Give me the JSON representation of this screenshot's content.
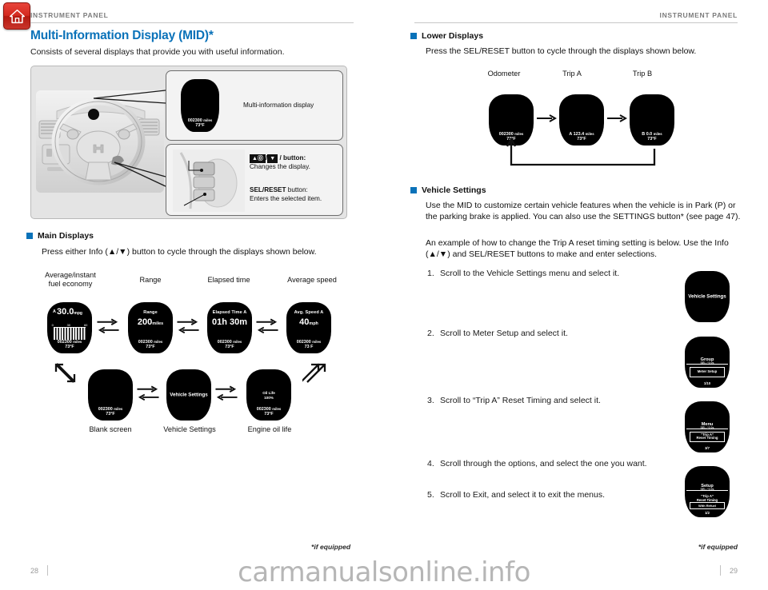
{
  "home_button": {
    "icon": "home-icon",
    "color": "#c9352b"
  },
  "running_head": {
    "left": "INSTRUMENT PANEL",
    "right": "INSTRUMENT PANEL"
  },
  "accent_color": "#0a72b9",
  "left": {
    "title": "Multi-Information Display (MID)*",
    "intro": "Consists of several displays that provide you with useful information.",
    "figure": {
      "callout_top_label": "Multi-information display",
      "callout_button_label_bold": "/  button:",
      "callout_button_prefix_icons": "▲(i) / ▼",
      "callout_button_desc": "Changes the display.",
      "callout_sel_bold": "SEL/RESET",
      "callout_sel_bold_suffix": " button:",
      "callout_sel_desc": "Enters the selected item.",
      "mid_preview": {
        "bottom_value": "002300",
        "bottom_unit": "miles",
        "temp": "73°F"
      }
    },
    "main_displays": {
      "heading": "Main Displays",
      "description": "Press either Info (▲/▼) button to cycle through the displays shown below.",
      "row1_captions": [
        "Average/instant\nfuel economy",
        "Range",
        "Elapsed time",
        "Average speed"
      ],
      "row2_captions": [
        "Blank screen",
        "Vehicle Settings",
        "Engine oil life"
      ],
      "screens": [
        {
          "id": "fuel-economy",
          "top_left": "A",
          "main": "30.0",
          "unit": "mpg",
          "scale": [
            "0",
            "30",
            "60"
          ],
          "odometer": "002300",
          "odo_unit": "miles",
          "temp": "73°F"
        },
        {
          "id": "range",
          "title": "Range",
          "main": "200",
          "unit": "miles",
          "odometer": "002300",
          "odo_unit": "miles",
          "temp": "73°F"
        },
        {
          "id": "elapsed-time",
          "title": "Elapsed Time A",
          "main": "01h 30m",
          "odometer": "002300",
          "odo_unit": "miles",
          "temp": "73°F"
        },
        {
          "id": "average-speed",
          "title": "Avg. Speed A",
          "main": "40",
          "unit": "mph",
          "odometer": "002300",
          "odo_unit": "miles",
          "temp": "73 F"
        },
        {
          "id": "blank-screen",
          "title": "",
          "odometer": "002300",
          "odo_unit": "miles",
          "temp": "73°F"
        },
        {
          "id": "vehicle-settings",
          "center": "Vehicle Settings"
        },
        {
          "id": "engine-oil-life",
          "oil_label": "Oil Life",
          "oil_value": "100%",
          "odometer": "002300",
          "odo_unit": "miles",
          "temp": "73°F"
        }
      ]
    },
    "footnote": "*if equipped",
    "folio": "28"
  },
  "right": {
    "lower_displays": {
      "heading": "Lower Displays",
      "description": "Press the SEL/RESET button to cycle through the displays shown below.",
      "captions": [
        "Odometer",
        "Trip A",
        "Trip B"
      ],
      "screens": [
        {
          "id": "odometer",
          "value": "002300",
          "unit": "miles",
          "temp": "73°F"
        },
        {
          "id": "trip-a",
          "value": "A 123.4",
          "unit": "miles",
          "temp": "73°F"
        },
        {
          "id": "trip-b",
          "value": "B 0.0",
          "unit": "miles",
          "temp": "73°F"
        }
      ]
    },
    "vehicle_settings": {
      "heading": "Vehicle Settings",
      "paragraph1": "Use the MID to customize certain vehicle features when the vehicle is in Park (P) or the parking brake is applied. You can also use the SETTINGS button* (see page 47).",
      "paragraph2": "An example of how to change the Trip A reset timing setting is below. Use the Info (▲/▼) and SEL/RESET buttons to make and enter selections.",
      "steps": [
        {
          "n": "1.",
          "text": "Scroll to the Vehicle Settings menu and select it."
        },
        {
          "n": "2.",
          "text": "Scroll to Meter Setup and select it."
        },
        {
          "n": "3.",
          "text": "Scroll to “Trip A” Reset Timing and select it."
        },
        {
          "n": "4.",
          "text": "Scroll through the options, and select the one you want."
        },
        {
          "n": "5.",
          "text": "Scroll to Exit, and select it to exit the menus."
        }
      ],
      "step_screens": [
        {
          "id": "step1-vehicle-settings",
          "center": "Vehicle Settings"
        },
        {
          "id": "step2-meter-setup",
          "title": "Group",
          "sub": "SEL / 0.0s",
          "box": "Meter Setup",
          "page": "1/10"
        },
        {
          "id": "step3-trip-a-reset-timing",
          "title": "Menu",
          "sub": "SEL / 0.0s",
          "box": "“Trip A”\nReset Timing",
          "page": "3/7"
        },
        {
          "id": "step4-with-refuel",
          "title": "Setup",
          "sub": "SEL / 0.0s",
          "mid_line": "“Trip A”\nReset Timing",
          "box": "With Refuel",
          "page": "1/2"
        }
      ]
    },
    "footnote": "*if equipped",
    "folio": "29"
  },
  "watermark": "carmanualsonline.info"
}
